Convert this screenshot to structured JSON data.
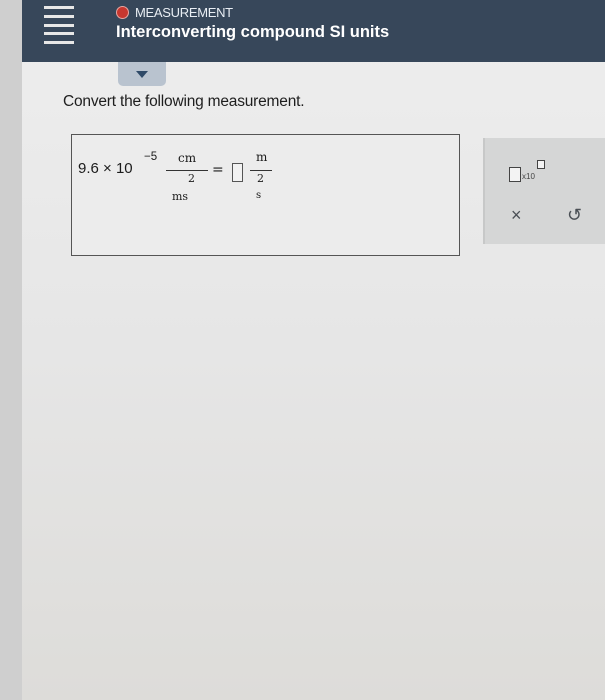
{
  "header": {
    "module": "MEASUREMENT",
    "title": "Interconverting compound SI units"
  },
  "question": {
    "instructions": "Convert the following measurement."
  },
  "expression": {
    "coefficient": "9.6 × 10",
    "exponent": "−5",
    "given_unit_numerator": "cm",
    "given_unit_denominator": "ms",
    "given_unit_denominator_exponent": "2",
    "equals": "=",
    "answer_value": "",
    "target_unit_numerator": "m",
    "target_unit_denominator": "s",
    "target_unit_denominator_exponent": "2"
  },
  "toolbar": {
    "sci_notation_label": "x10",
    "clear_icon": "×",
    "undo_icon": "↺"
  },
  "colors": {
    "header_bg": "#37475a",
    "module_dot": "#c7372f",
    "tab_bg": "#b9c3cf"
  }
}
